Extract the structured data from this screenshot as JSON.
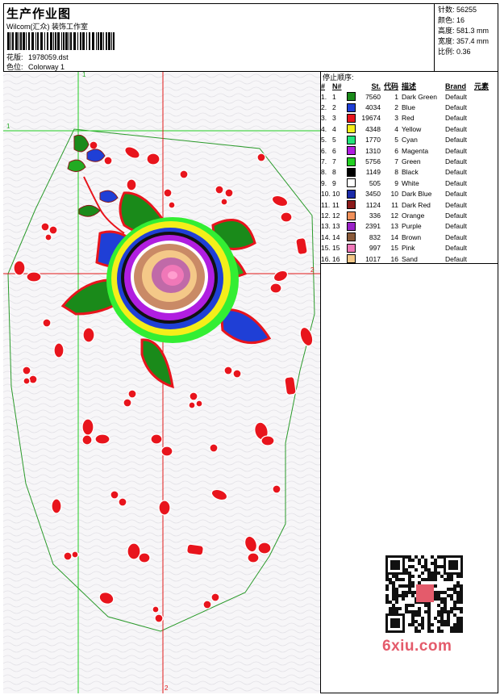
{
  "header": {
    "title": "生产作业图",
    "company": "Wilcom(汇众) 装饰工作室",
    "design_label": "花版:",
    "design_file": "1978059.dst",
    "colorway_label": "色位:",
    "colorway": "Colorway 1"
  },
  "stats": {
    "stitches_label": "针数:",
    "stitches": "56255",
    "colors_label": "颜色:",
    "colors": "16",
    "height_label": "高度:",
    "height": "581.3 mm",
    "width_label": "宽度:",
    "width": "357.4 mm",
    "scale_label": "比例:",
    "scale": "0.36"
  },
  "stoplist": {
    "caption": "停止顺序:",
    "columns": [
      "#",
      "N#",
      "St.",
      "代码",
      "描述",
      "Brand",
      "元素"
    ],
    "rows": [
      {
        "n": "1.",
        "nn": "1",
        "color": "#1a8a1a",
        "st": "7560",
        "code": "1",
        "desc": "Dark Green",
        "brand": "Default"
      },
      {
        "n": "2.",
        "nn": "2",
        "color": "#1f3fd6",
        "st": "4034",
        "code": "2",
        "desc": "Blue",
        "brand": "Default"
      },
      {
        "n": "3.",
        "nn": "3",
        "color": "#e8141c",
        "st": "19674",
        "code": "3",
        "desc": "Red",
        "brand": "Default"
      },
      {
        "n": "4.",
        "nn": "4",
        "color": "#f4ee1a",
        "st": "4348",
        "code": "4",
        "desc": "Yellow",
        "brand": "Default"
      },
      {
        "n": "5.",
        "nn": "5",
        "color": "#22e47a",
        "st": "1770",
        "code": "5",
        "desc": "Cyan",
        "brand": "Default"
      },
      {
        "n": "6.",
        "nn": "6",
        "color": "#b01ee0",
        "st": "1310",
        "code": "6",
        "desc": "Magenta",
        "brand": "Default"
      },
      {
        "n": "7.",
        "nn": "7",
        "color": "#22d022",
        "st": "5756",
        "code": "7",
        "desc": "Green",
        "brand": "Default"
      },
      {
        "n": "8.",
        "nn": "8",
        "color": "#000000",
        "st": "1149",
        "code": "8",
        "desc": "Black",
        "brand": "Default"
      },
      {
        "n": "9.",
        "nn": "9",
        "color": "#ffffff",
        "st": "505",
        "code": "9",
        "desc": "White",
        "brand": "Default"
      },
      {
        "n": "10.",
        "nn": "10",
        "color": "#1a2aa8",
        "st": "3450",
        "code": "10",
        "desc": "Dark Blue",
        "brand": "Default"
      },
      {
        "n": "11.",
        "nn": "11",
        "color": "#8a1a1a",
        "st": "1124",
        "code": "11",
        "desc": "Dark Red",
        "brand": "Default"
      },
      {
        "n": "12.",
        "nn": "12",
        "color": "#f0905a",
        "st": "336",
        "code": "12",
        "desc": "Orange",
        "brand": "Default"
      },
      {
        "n": "13.",
        "nn": "13",
        "color": "#9a22c8",
        "st": "2391",
        "code": "13",
        "desc": "Purple",
        "brand": "Default"
      },
      {
        "n": "14.",
        "nn": "14",
        "color": "#8a5a3a",
        "st": "832",
        "code": "14",
        "desc": "Brown",
        "brand": "Default"
      },
      {
        "n": "15.",
        "nn": "15",
        "color": "#f078b8",
        "st": "997",
        "code": "15",
        "desc": "Pink",
        "brand": "Default"
      },
      {
        "n": "16.",
        "nn": "16",
        "color": "#f4c888",
        "st": "1017",
        "code": "16",
        "desc": "Sand",
        "brand": "Default"
      }
    ]
  },
  "canvas": {
    "guide_h_label": "1",
    "guide_v_label": "1",
    "axis_h_label": "2",
    "axis_v_label": "2"
  },
  "watermark": "6xiu.com"
}
